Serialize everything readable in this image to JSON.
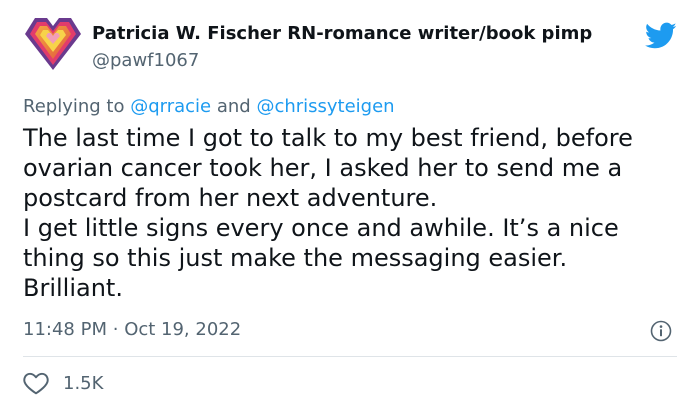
{
  "author": {
    "name": "Patricia W. Fischer RN-romance writer/book pimp",
    "handle": "@pawf1067",
    "avatar_icon": "heart-emblem-icon"
  },
  "platform_icon": "twitter-bird-icon",
  "reply": {
    "prefix": "Replying to ",
    "mention1": "@qrracie",
    "joiner": " and ",
    "mention2": "@chrissyteigen"
  },
  "tweet": {
    "lines": [
      "The last time I got to talk to my best friend, before",
      "ovarian cancer took her, I asked her to send me a",
      "postcard from her next adventure.",
      "I get little signs every once and awhile. It’s a nice",
      "thing so this just make the messaging easier.",
      "Brilliant."
    ],
    "time": "11:48 PM",
    "separator": "·",
    "date": "Oct 19, 2022"
  },
  "likes": {
    "count": "1.5K",
    "icon": "heart-outline-icon"
  },
  "info_icon": "info-icon",
  "colors": {
    "accent": "#1d9bf0",
    "text": "#0f1419",
    "secondary": "#536471"
  }
}
